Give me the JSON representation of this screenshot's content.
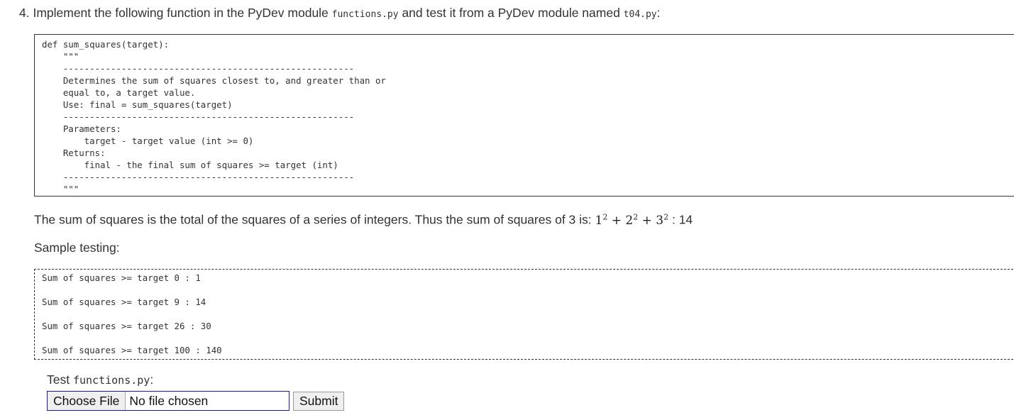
{
  "question": {
    "prefix": "4. Implement the following function in the PyDev module ",
    "module_file": "functions.py",
    "middle": " and test it from a PyDev module named ",
    "test_file": "t04.py",
    "suffix": ":"
  },
  "code": {
    "lines": [
      "def sum_squares(target):",
      "    \"\"\"",
      "    -------------------------------------------------------",
      "    Determines the sum of squares closest to, and greater than or",
      "    equal to, a target value.",
      "    Use: final = sum_squares(target)",
      "    -------------------------------------------------------",
      "    Parameters:",
      "        target - target value (int >= 0)",
      "    Returns:",
      "        final - the final sum of squares >= target (int)",
      "    -------------------------------------------------------",
      "    \"\"\""
    ]
  },
  "explanation": {
    "text": "The sum of squares is the total of the squares of a series of integers. Thus the sum of squares of 3 is: ",
    "terms": [
      "1",
      "2",
      "3"
    ],
    "exponent": "2",
    "plus": " + ",
    "result": " : 14"
  },
  "sample": {
    "label": "Sample testing:",
    "lines": [
      "Sum of squares >= target 0 : 1",
      "Sum of squares >= target 9 : 14",
      "Sum of squares >= target 26 : 30",
      "Sum of squares >= target 100 : 140"
    ]
  },
  "upload": {
    "label_prefix": "Test ",
    "label_file": "functions.py",
    "label_suffix": ":",
    "choose_label": "Choose File",
    "status": "No file chosen",
    "submit_label": "Submit"
  }
}
